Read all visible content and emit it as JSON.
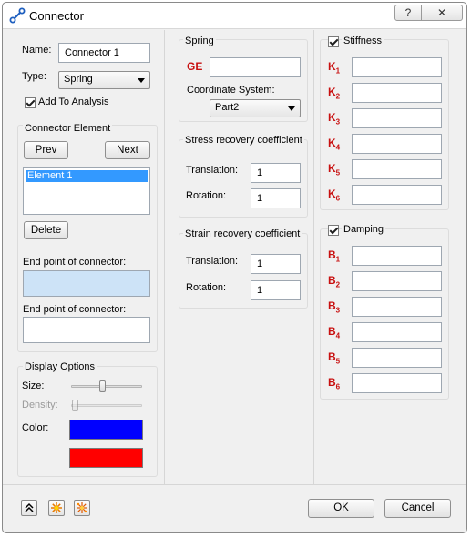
{
  "window": {
    "title": "Connector",
    "help_label": "?",
    "close_label": "✕"
  },
  "left": {
    "name_label": "Name:",
    "name_value": "Connector 1",
    "type_label": "Type:",
    "type_value": "Spring",
    "add_to_analysis_label": "Add To Analysis",
    "add_to_analysis_checked": true,
    "connector_element": {
      "group_label": "Connector Element",
      "prev_label": "Prev",
      "next_label": "Next",
      "elements": [
        "Element 1"
      ],
      "delete_label": "Delete",
      "end_point_1_label": "End point of connector:",
      "end_point_1_value": "",
      "end_point_2_label": "End point of connector:",
      "end_point_2_value": ""
    },
    "display_options": {
      "group_label": "Display Options",
      "size_label": "Size:",
      "density_label": "Density:",
      "color_label": "Color:",
      "color_1": "#0000ff",
      "color_2": "#ff0000"
    }
  },
  "middle": {
    "spring": {
      "group_label": "Spring",
      "ge_label": "GE",
      "ge_value": "",
      "coord_system_label": "Coordinate System:",
      "coord_system_value": "Part2"
    },
    "stress_recovery": {
      "group_label": "Stress recovery coefficient",
      "translation_label": "Translation:",
      "translation_value": "1",
      "rotation_label": "Rotation:",
      "rotation_value": "1"
    },
    "strain_recovery": {
      "group_label": "Strain recovery coefficient",
      "translation_label": "Translation:",
      "translation_value": "1",
      "rotation_label": "Rotation:",
      "rotation_value": "1"
    }
  },
  "right": {
    "stiffness": {
      "label": "Stiffness",
      "checked": true,
      "prefix": "K",
      "subs": [
        "1",
        "2",
        "3",
        "4",
        "5",
        "6"
      ]
    },
    "damping": {
      "label": "Damping",
      "checked": true,
      "prefix": "B",
      "subs": [
        "1",
        "2",
        "3",
        "4",
        "5",
        "6"
      ]
    }
  },
  "footer": {
    "ok_label": "OK",
    "cancel_label": "Cancel",
    "tool_icons": [
      "collapse-up-icon",
      "sun-icon",
      "sun-multi-icon"
    ]
  }
}
